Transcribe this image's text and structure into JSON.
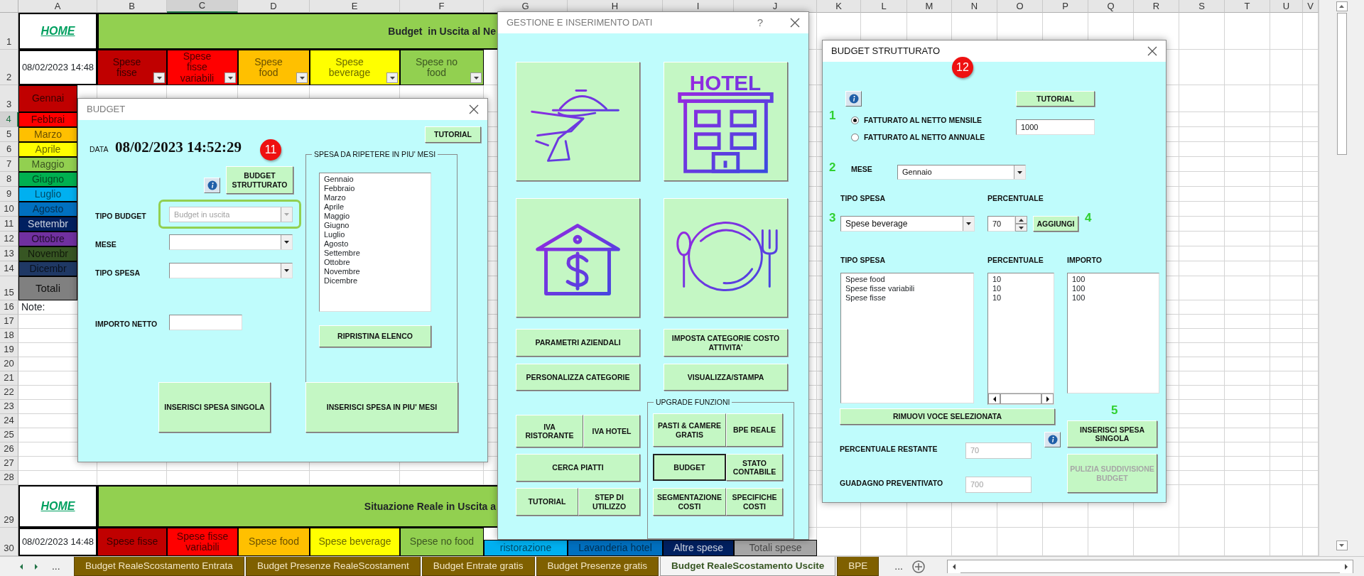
{
  "sheet": {
    "columns": [
      {
        "label": "A",
        "selected": false
      },
      {
        "label": "B",
        "selected": false
      },
      {
        "label": "C",
        "selected": true
      },
      {
        "label": "D",
        "selected": false
      },
      {
        "label": "E",
        "selected": false
      },
      {
        "label": "F",
        "selected": false
      },
      {
        "label": "G",
        "selected": false
      },
      {
        "label": "H",
        "selected": false
      },
      {
        "label": "I",
        "selected": false
      },
      {
        "label": "J",
        "selected": false
      },
      {
        "label": "K",
        "selected": false
      },
      {
        "label": "L",
        "selected": false
      },
      {
        "label": "M",
        "selected": false
      },
      {
        "label": "N",
        "selected": false
      },
      {
        "label": "O",
        "selected": false
      },
      {
        "label": "P",
        "selected": false
      },
      {
        "label": "Q",
        "selected": false
      },
      {
        "label": "R",
        "selected": false
      },
      {
        "label": "S",
        "selected": false
      },
      {
        "label": "T",
        "selected": false
      },
      {
        "label": "U",
        "selected": false
      },
      {
        "label": "V",
        "selected": false
      }
    ],
    "rows": [
      {
        "label": "1",
        "selected": false
      },
      {
        "label": "2",
        "selected": false
      },
      {
        "label": "3",
        "selected": false
      },
      {
        "label": "4",
        "selected": true
      },
      {
        "label": "5",
        "selected": false
      },
      {
        "label": "6",
        "selected": false
      },
      {
        "label": "7",
        "selected": false
      },
      {
        "label": "8",
        "selected": false
      },
      {
        "label": "9",
        "selected": false
      },
      {
        "label": "10",
        "selected": false
      },
      {
        "label": "11",
        "selected": false
      },
      {
        "label": "12",
        "selected": false
      },
      {
        "label": "13",
        "selected": false
      },
      {
        "label": "14",
        "selected": false
      },
      {
        "label": "15",
        "selected": false
      },
      {
        "label": "16",
        "selected": false
      },
      {
        "label": "17",
        "selected": false
      },
      {
        "label": "18",
        "selected": false
      },
      {
        "label": "19",
        "selected": false
      },
      {
        "label": "20",
        "selected": false
      },
      {
        "label": "21",
        "selected": false
      },
      {
        "label": "22",
        "selected": false
      },
      {
        "label": "23",
        "selected": false
      },
      {
        "label": "24",
        "selected": false
      },
      {
        "label": "25",
        "selected": false
      },
      {
        "label": "26",
        "selected": false
      },
      {
        "label": "27",
        "selected": false
      },
      {
        "label": "28",
        "selected": false
      },
      {
        "label": "29",
        "selected": false
      },
      {
        "label": "30",
        "selected": false
      }
    ],
    "top_section": {
      "home_link": "HOME",
      "title": "Budget  in Uscita al Ne",
      "timestamp": "08/02/2023 14:48",
      "headers": [
        {
          "label": "Spese fisse",
          "color": "#c00000"
        },
        {
          "label": "Spese fisse variabili",
          "color": "#ff0000"
        },
        {
          "label": "Spese food",
          "color": "#ffc000"
        },
        {
          "label": "Spese beverage",
          "color": "#ffff00"
        },
        {
          "label": "Spese no food",
          "color": "#92d050"
        }
      ],
      "months": [
        {
          "label": "Gennai",
          "color": "#c00000"
        },
        {
          "label": "Febbrai",
          "color": "#ff0000"
        },
        {
          "label": "Marzo",
          "color": "#ffc000"
        },
        {
          "label": "Aprile",
          "color": "#ffff00"
        },
        {
          "label": "Maggio",
          "color": "#92d050"
        },
        {
          "label": "Giugno",
          "color": "#00b050"
        },
        {
          "label": "Luglio",
          "color": "#00b0f0"
        },
        {
          "label": "Agosto",
          "color": "#0070c0"
        },
        {
          "label": "Settembr",
          "color": "#002060"
        },
        {
          "label": "Ottobre",
          "color": "#7030a0"
        },
        {
          "label": "Novembr",
          "color": "#375623"
        },
        {
          "label": "Dicembr",
          "color": "#1f3864"
        }
      ],
      "totals_label": "Totali",
      "note_label": "Note:"
    },
    "bottom_section": {
      "home_link": "HOME",
      "title": "Situazione Reale in Uscita a",
      "timestamp": "08/02/2023 14:48",
      "headers": [
        {
          "label": "Spese fisse",
          "color": "#c00000"
        },
        {
          "label": "Spese fisse variabili",
          "color": "#ff0000"
        },
        {
          "label": "Spese food",
          "color": "#ffc000"
        },
        {
          "label": "Spese beverage",
          "color": "#ffff00"
        },
        {
          "label": "Spese no food",
          "color": "#92d050"
        },
        {
          "label": "ristorazione",
          "color": "#00b0f0"
        },
        {
          "label": "Lavanderia hotel",
          "color": "#0070c0"
        },
        {
          "label": "Altre spese",
          "color": "#002060"
        },
        {
          "label": "Totali spese",
          "color": "#a6a6a6"
        }
      ]
    },
    "tab_more_left": "...",
    "tab_more_right": "...",
    "sheet_tabs": [
      {
        "label": "Budget RealeScostamento Entrata",
        "selected": false
      },
      {
        "label": "Budget Presenze RealeScostament",
        "selected": false
      },
      {
        "label": "Budget Entrate gratis",
        "selected": false
      },
      {
        "label": "Budget Presenze gratis",
        "selected": false
      },
      {
        "label": "Budget RealeScostamento Uscite",
        "selected": true
      },
      {
        "label": "BPE",
        "selected": false
      }
    ]
  },
  "budget_dialog": {
    "title": "BUDGET",
    "date_label": "DATA",
    "date_value": "08/02/2023 14:52:29",
    "step_badge": "11",
    "tutorial_button": "TUTORIAL",
    "structured_button": "BUDGET STRUTTURATO",
    "fields": [
      {
        "label": "TIPO BUDGET",
        "kind": "combobox",
        "value": "Budget in uscita",
        "disabled": true,
        "highlighted": true
      },
      {
        "label": "MESE",
        "kind": "combobox",
        "disabled": false,
        "highlighted": false
      },
      {
        "label": "TIPO SPESA",
        "kind": "combobox",
        "disabled": false,
        "highlighted": false
      },
      {
        "label": "IMPORTO NETTO",
        "kind": "textbox",
        "disabled": false,
        "highlighted": false
      }
    ],
    "repeat_group": {
      "title": "SPESA DA RIPETERE IN PIU' MESI",
      "months": [
        "Gennaio",
        "Febbraio",
        "Marzo",
        "Aprile",
        "Maggio",
        "Giugno",
        "Luglio",
        "Agosto",
        "Settembre",
        "Ottobre",
        "Novembre",
        "Dicembre"
      ],
      "reset_button": "RIPRISTINA ELENCO"
    },
    "insert_single_button": "INSERISCI SPESA SINGOLA",
    "insert_multi_button": "INSERISCI SPESA IN PIU' MESI"
  },
  "data_dialog": {
    "title": "GESTIONE E INSERIMENTO DATI",
    "help_glyph": "?",
    "image_buttons": [
      {
        "kind": "waiter"
      },
      {
        "kind": "hotel",
        "label": "HOTEL"
      },
      {
        "kind": "house_money"
      },
      {
        "kind": "plate"
      }
    ],
    "buttons": [
      "PARAMETRI AZIENDALI",
      "IMPOSTA CATEGORIE COSTO ATTIVITA'",
      "PERSONALIZZA CATEGORIE",
      "VISUALIZZA/STAMPA",
      "IVA RISTORANTE",
      "IVA HOTEL",
      "CERCA PIATTI",
      "TUTORIAL",
      "STEP DI UTILIZZO"
    ],
    "upgrade_group": {
      "title": "UPGRADE FUNZIONI",
      "buttons": [
        {
          "label": "PASTI & CAMERE GRATIS",
          "selected": false
        },
        {
          "label": "BPE REALE",
          "selected": false
        },
        {
          "label": "BUDGET",
          "selected": true
        },
        {
          "label": "STATO CONTABILE",
          "selected": false
        },
        {
          "label": "SEGMENTAZIONE COSTI",
          "selected": false
        },
        {
          "label": "SPECIFICHE COSTI",
          "selected": false
        }
      ]
    }
  },
  "structured_dialog": {
    "title": "BUDGET STRUTTURATO",
    "step_badge": "12",
    "tutorial_button": "TUTORIAL",
    "steps": [
      "1",
      "2",
      "3",
      "4",
      "5"
    ],
    "basis_options": [
      {
        "label": "FATTURATO AL NETTO MENSILE",
        "selected": true
      },
      {
        "label": "FATTURATO AL NETTO ANNUALE",
        "selected": false
      }
    ],
    "revenue_value": "1000",
    "month_label": "MESE",
    "month_value": "Gennaio",
    "type_label": "TIPO SPESA",
    "percent_label": "PERCENTUALE",
    "type_value": "Spese beverage",
    "percent_value": "70",
    "add_button": "AGGIUNGI",
    "list_headers": [
      "TIPO SPESA",
      "PERCENTUALE",
      "IMPORTO"
    ],
    "list_types": [
      "Spese food",
      "Spese fisse variabili",
      "Spese fisse"
    ],
    "list_percents": [
      "10",
      "10",
      "10"
    ],
    "list_amounts": [
      "100",
      "100",
      "100"
    ],
    "remove_button": "RIMUOVI VOCE SELEZIONATA",
    "insert_button": "INSERISCI SPESA SINGOLA",
    "remaining": {
      "label": "PERCENTUALE RESTANTE",
      "value": "70",
      "disabled": true
    },
    "forecast": {
      "label": "GUADAGNO PREVENTIVATO",
      "value": "700",
      "disabled": true
    },
    "clear_button": {
      "label": "PULIZIA SUDDIVISIONE BUDGET",
      "disabled": true
    }
  }
}
